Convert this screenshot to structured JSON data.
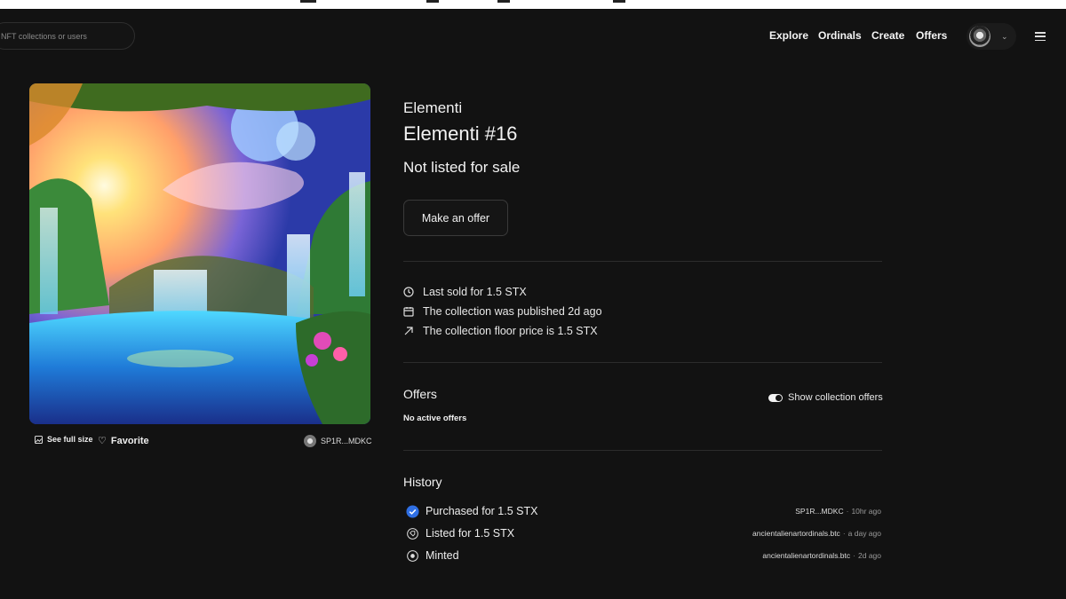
{
  "header": {
    "search_placeholder": "NFT collections or users",
    "nav": [
      "Explore",
      "Ordinals",
      "Create",
      "Offers"
    ]
  },
  "artwork": {
    "see_full_size": "See full size",
    "favorite": "Favorite",
    "owner": "SP1R...MDKC"
  },
  "details": {
    "collection": "Elementi",
    "token": "Elementi #16",
    "status": "Not listed for sale",
    "make_offer": "Make an offer",
    "facts": [
      {
        "icon": "clock-icon",
        "text": "Last sold for 1.5 STX"
      },
      {
        "icon": "calendar-icon",
        "text": "The collection was published 2d ago"
      },
      {
        "icon": "arrow-up-right-icon",
        "text": "The collection floor price is 1.5 STX"
      }
    ]
  },
  "offers": {
    "title": "Offers",
    "empty": "No active offers",
    "toggle_label": "Show collection offers",
    "toggle_on": true
  },
  "history": {
    "title": "History",
    "events": [
      {
        "icon": "verified-check-icon",
        "label": "Purchased for 1.5 STX",
        "user": "SP1R...MDKC",
        "time": "10hr ago"
      },
      {
        "icon": "tag-icon",
        "label": "Listed for 1.5 STX",
        "user": "ancientalienartordinals.btc",
        "time": "a day ago"
      },
      {
        "icon": "mint-icon",
        "label": "Minted",
        "user": "ancientalienartordinals.btc",
        "time": "2d ago"
      }
    ]
  },
  "colors": {
    "background": "#121212",
    "verified": "#2f6fe4"
  }
}
